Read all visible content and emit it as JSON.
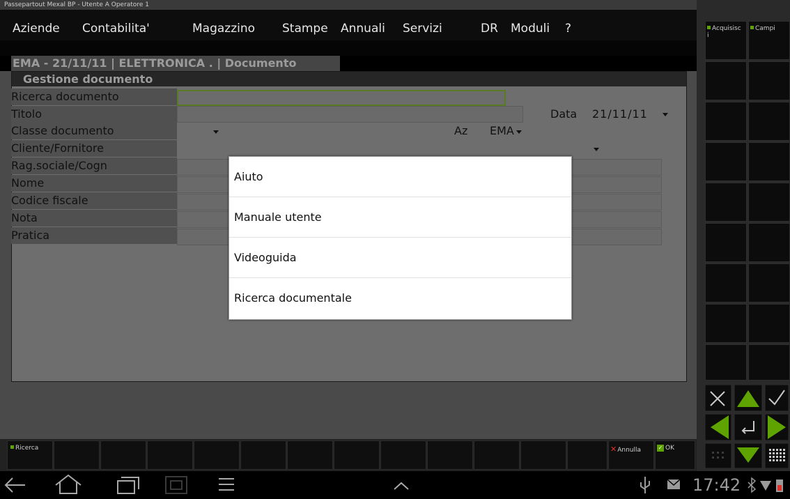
{
  "app": {
    "title": "Passepartout Mexal BP - Utente A Operatore 1"
  },
  "menu": {
    "items": [
      "Aziende",
      "Contabilita'",
      "Magazzino",
      "Stampe",
      "Annuali",
      "Servizi",
      "DR",
      "Moduli",
      "?"
    ]
  },
  "document_tab": "EMA - 21/11/11 | ELETTRONICA . | Documento",
  "form": {
    "title": "Gestione documento",
    "labels": {
      "ricerca": "Ricerca documento",
      "titolo": "Titolo",
      "classe": "Classe documento",
      "cliente": "Cliente/Fornitore",
      "ragsoc": "Rag.sociale/Cogn",
      "nome": "Nome",
      "codfisc": "Codice fiscale",
      "nota": "Nota",
      "pratica": "Pratica"
    },
    "data_label": "Data",
    "data_value": "21/11/11",
    "az_label": "Az",
    "az_value": "EMA"
  },
  "popup": {
    "items": [
      "Aiuto",
      "Manuale utente",
      "Videoguida",
      "Ricerca documentale"
    ]
  },
  "function_bar": {
    "ricerca": "Ricerca",
    "annulla": "Annulla",
    "ok": "OK"
  },
  "right_panel": {
    "acquisisci": "Acquisisc\ni",
    "campi": "Campi"
  },
  "status": {
    "clock": "17:42"
  },
  "colors": {
    "accent_green": "#5ea300",
    "cancel_red": "#e0302a",
    "focus_border": "#5b7a26"
  }
}
